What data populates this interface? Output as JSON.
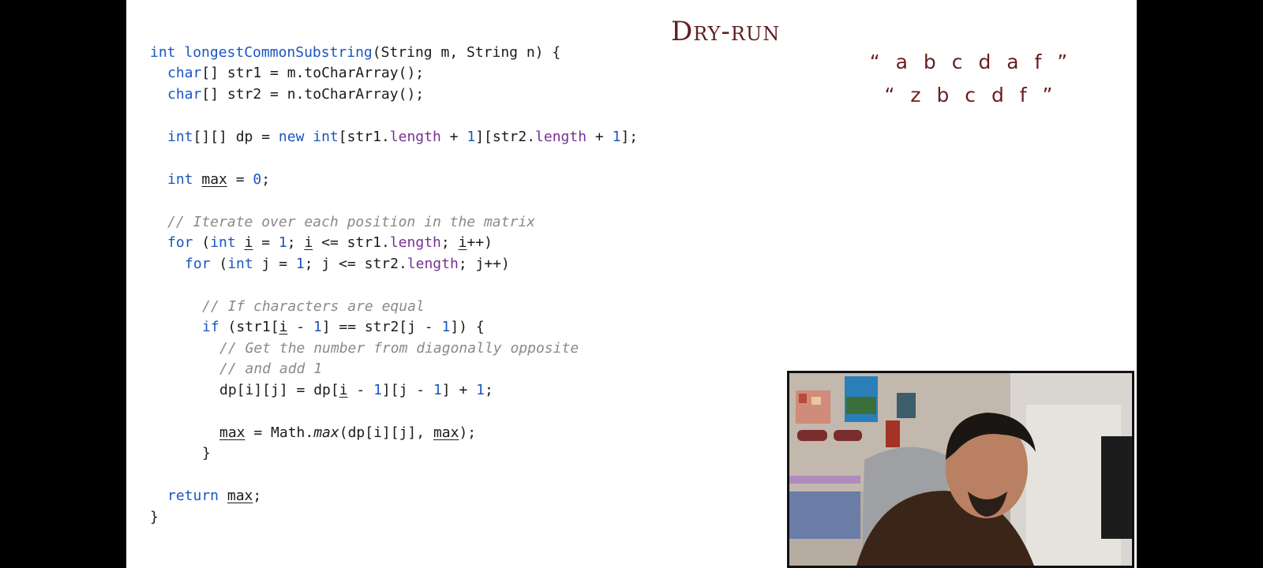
{
  "slide": {
    "title": "Dry-run",
    "strings": [
      "“ a b c d a f ”",
      "“ z b c d f ”"
    ]
  },
  "code": {
    "l1": {
      "kw": "int",
      "name": "longestCommonSubstring",
      "rest": "(String m, String n) {"
    },
    "l2": {
      "kw": "char",
      "rest": "[] str1 = m.toCharArray();"
    },
    "l3": {
      "kw": "char",
      "rest": "[] str2 = n.toCharArray();"
    },
    "l4": {
      "kw1": "int",
      "a": "[][] dp = ",
      "kw2": "new",
      "kw3": "int",
      "b": "[str1.",
      "p1": "length",
      "c": " + ",
      "n1": "1",
      "d": "][str2.",
      "p2": "length",
      "e": " + ",
      "n2": "1",
      "f": "];"
    },
    "l5": {
      "kw": "int",
      "var": "max",
      "a": " = ",
      "num": "0",
      "b": ";"
    },
    "l6": {
      "comment": "// Iterate over each position in the matrix"
    },
    "l7": {
      "kw1": "for",
      "a": " (",
      "kw2": "int",
      "b": " ",
      "v1": "i",
      "c": " = ",
      "n1": "1",
      "d": "; ",
      "v2": "i",
      "e": " <= str1.",
      "p": "length",
      "f": "; ",
      "v3": "i",
      "g": "++)"
    },
    "l8": {
      "kw1": "for",
      "a": " (",
      "kw2": "int",
      "b": " j = ",
      "n1": "1",
      "c": "; j <= str2.",
      "p": "length",
      "d": "; j++)"
    },
    "l9": {
      "comment": "// If characters are equal"
    },
    "l10": {
      "kw": "if",
      "a": " (str1[",
      "v1": "i",
      "b": " - ",
      "n1": "1",
      "c": "] == str2[j - ",
      "n2": "1",
      "d": "]) {"
    },
    "l11": {
      "comment": "// Get the number from diagonally opposite"
    },
    "l12": {
      "comment": "// and add 1"
    },
    "l13": {
      "a": "dp[i][j] = dp[",
      "v": "i",
      "b": " - ",
      "n1": "1",
      "c": "][j - ",
      "n2": "1",
      "d": "] + ",
      "n3": "1",
      "e": ";"
    },
    "l14": {
      "v1": "max",
      "a": " = Math.",
      "fn": "max",
      "b": "(dp[i][j], ",
      "v2": "max",
      "c": ");"
    },
    "l15": {
      "a": "}"
    },
    "l16": {
      "kw": "return",
      "b": " ",
      "v": "max",
      "c": ";"
    },
    "l17": {
      "a": "}"
    }
  },
  "webcam": {
    "subject": "presenter-video"
  }
}
